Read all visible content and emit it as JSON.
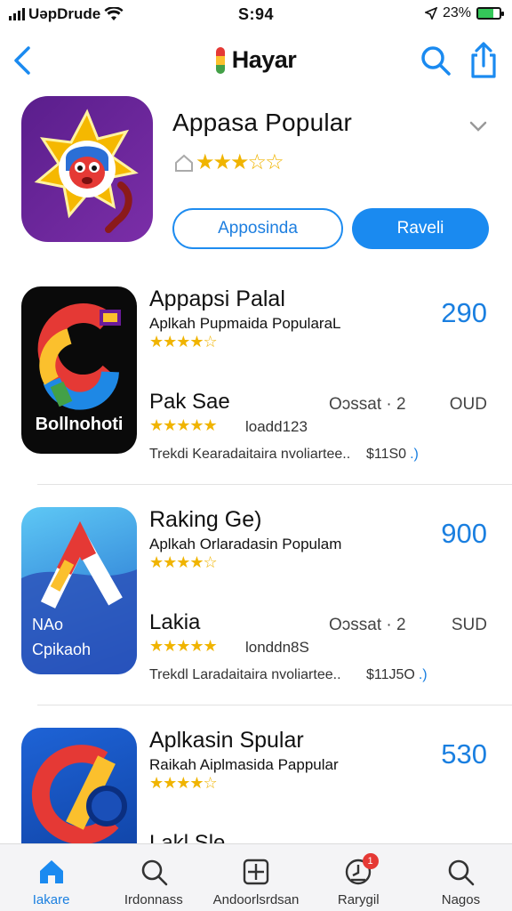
{
  "status_bar": {
    "carrier": "UǝpDrude",
    "time": "S:94",
    "battery_percent": "23%"
  },
  "nav": {
    "brand": "Hayar",
    "back_icon": "chevron-left-icon",
    "search_icon": "search-icon",
    "share_icon": "share-icon"
  },
  "hero": {
    "title": "Appasa Popular",
    "rating": 3.5,
    "stars": "★★★☆☆",
    "secondary_button": "Apposinda",
    "primary_button": "Raveli"
  },
  "apps": [
    {
      "title": "Appapsi Palal",
      "price": "290",
      "subtitle": "Aplkah Pupmaida PopularaL",
      "stars": "★★★★☆",
      "rating": 4,
      "title2": "Pak Sae",
      "meta": "Oɔssat · 2",
      "currency": "OUD",
      "stars2": "★★★★★",
      "rating2": 4.5,
      "downloads": "loadd123",
      "description": "Trekdi Kearadaitaira nvoliartee..",
      "small_price": "$11S0",
      "small_price_suffix": ".)",
      "icon_label": "Bollnohoti"
    },
    {
      "title": "Raking Ge)",
      "price": "900",
      "subtitle": "Aplkah Orlaradasin Populam",
      "stars": "★★★★☆",
      "rating": 4,
      "title2": "Lakia",
      "meta": "Oɔssat · 2",
      "currency": "SUD",
      "stars2": "★★★★★",
      "rating2": 4.5,
      "downloads": "londdn8S",
      "description": "Trekdl Laradaitaira nvoliartee..",
      "small_price": "$11J5O",
      "small_price_suffix": ".)",
      "icon_label_1": "NAo",
      "icon_label_2": "Cpikaoh"
    },
    {
      "title": "Aplkasin Spular",
      "price": "530",
      "subtitle": "Raikah Aiplmasida Pappular",
      "stars": "★★★★☆",
      "rating": 4,
      "title2": "Lakl Sle"
    }
  ],
  "tabs": [
    {
      "label": "Iakare",
      "icon": "home-icon",
      "active": true
    },
    {
      "label": "Irdonnass",
      "icon": "search-icon",
      "active": false
    },
    {
      "label": "Andoorlsrdsan",
      "icon": "add-square-icon",
      "active": false
    },
    {
      "label": "Rarygil",
      "icon": "clock-icon",
      "active": false,
      "badge": "1"
    },
    {
      "label": "Nagos",
      "icon": "search-icon",
      "active": false
    }
  ],
  "colors": {
    "accent": "#1a8af0",
    "star": "#f0b400",
    "battery": "#34c759"
  }
}
